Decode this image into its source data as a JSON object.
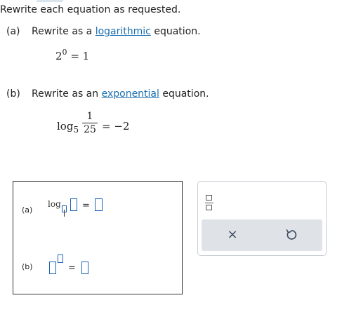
{
  "instructions": "Rewrite each equation as requested.",
  "parts": {
    "a": {
      "label": "(a)",
      "prompt_before": "Rewrite as a ",
      "link": "logarithmic",
      "prompt_after": " equation.",
      "base": "2",
      "exponent": "0",
      "rhs": "= 1"
    },
    "b": {
      "label": "(b)",
      "prompt_before": "Rewrite as an ",
      "link": "exponential",
      "prompt_after": " equation.",
      "log": "log",
      "base": "5",
      "numerator": "1",
      "denominator": "25",
      "rhs": "= −2"
    }
  },
  "answer": {
    "a_label": "(a)",
    "a_log": "log",
    "a_equals": "=",
    "b_label": "(b)",
    "b_equals": "="
  },
  "tools": {
    "fraction_icon": "fraction-template-icon",
    "clear_icon": "close-icon",
    "clear_symbol": "×",
    "undo_icon": "undo-icon"
  }
}
